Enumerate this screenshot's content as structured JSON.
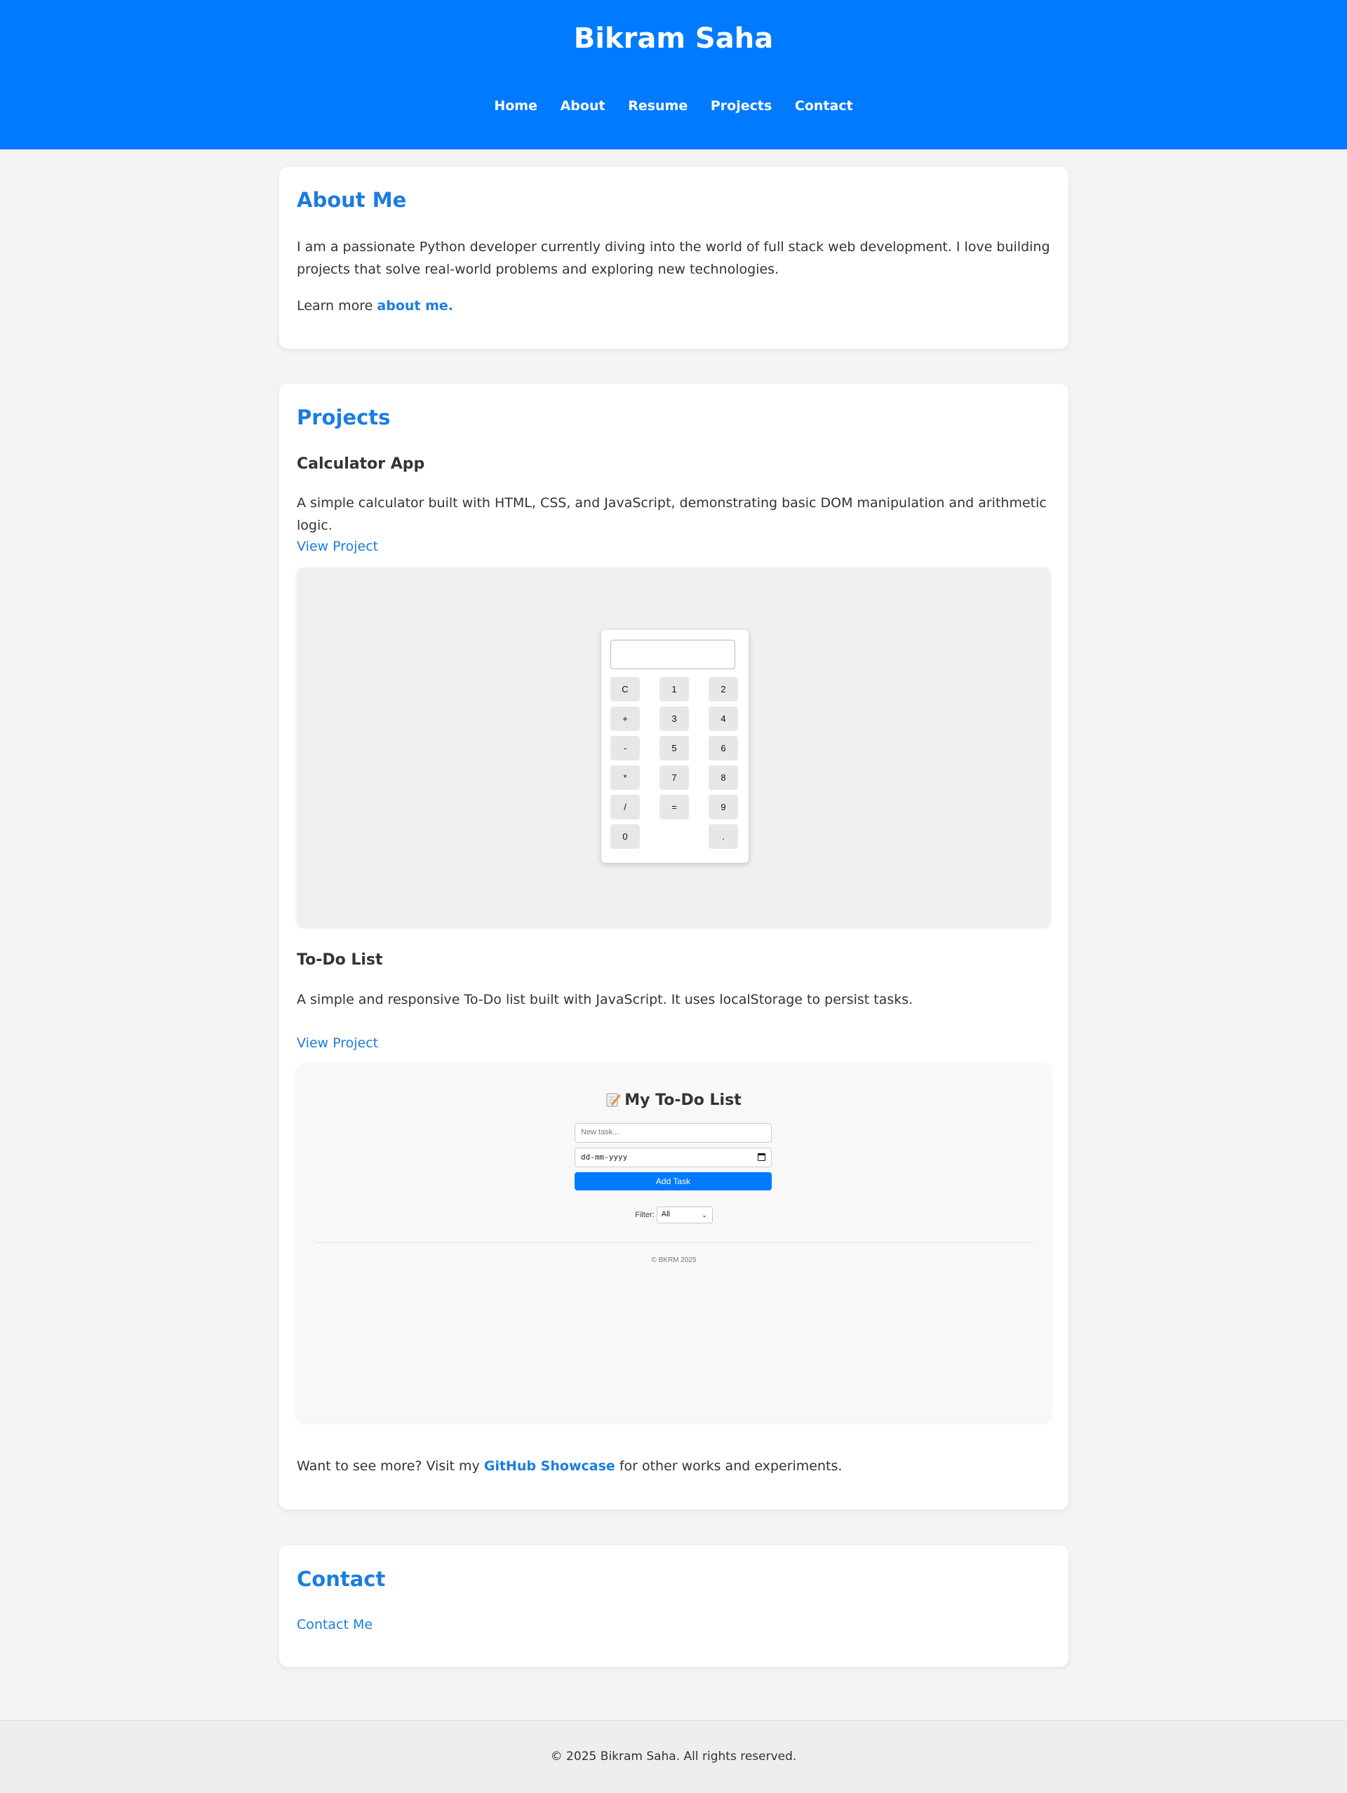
{
  "header": {
    "title": "Bikram Saha",
    "nav": [
      "Home",
      "About",
      "Resume",
      "Projects",
      "Contact"
    ]
  },
  "about": {
    "heading": "About Me",
    "paragraph": "I am a passionate Python developer currently diving into the world of full stack web development. I love building projects that solve real-world problems and exploring new technologies.",
    "learn_prefix": "Learn more ",
    "learn_link": "about me."
  },
  "projects": {
    "heading": "Projects",
    "items": [
      {
        "title": "Calculator App",
        "description": "A simple calculator built with HTML, CSS, and JavaScript, demonstrating basic DOM manipulation and arithmetic logic.",
        "link": "View Project"
      },
      {
        "title": "To-Do List",
        "description": "A simple and responsive To-Do list built with JavaScript. It uses localStorage to persist tasks.",
        "link": "View Project"
      }
    ],
    "calculator": {
      "buttons": [
        "C",
        "1",
        "2",
        "+",
        "3",
        "4",
        "-",
        "5",
        "6",
        "*",
        "7",
        "8",
        "/",
        "=",
        "9",
        "0",
        "",
        "."
      ]
    },
    "todo": {
      "title_icon": "memo-icon",
      "title": "My To-Do List",
      "task_placeholder": "New task...",
      "date_placeholder": "dd-mm-yyyy",
      "add_button": "Add Task",
      "filter_label": "Filter:",
      "filter_value": "All",
      "footer": "© BKRM 2025"
    },
    "more_prefix": "Want to see more? Visit my ",
    "more_link": "GitHub Showcase",
    "more_suffix": " for other works and experiments."
  },
  "contact": {
    "heading": "Contact",
    "link": "Contact Me"
  },
  "footer": {
    "text": "© 2025 Bikram Saha. All rights reserved."
  },
  "colors": {
    "header_bg": "#007bff",
    "accent": "#1a7de0",
    "page_bg": "#f4f4f4"
  }
}
